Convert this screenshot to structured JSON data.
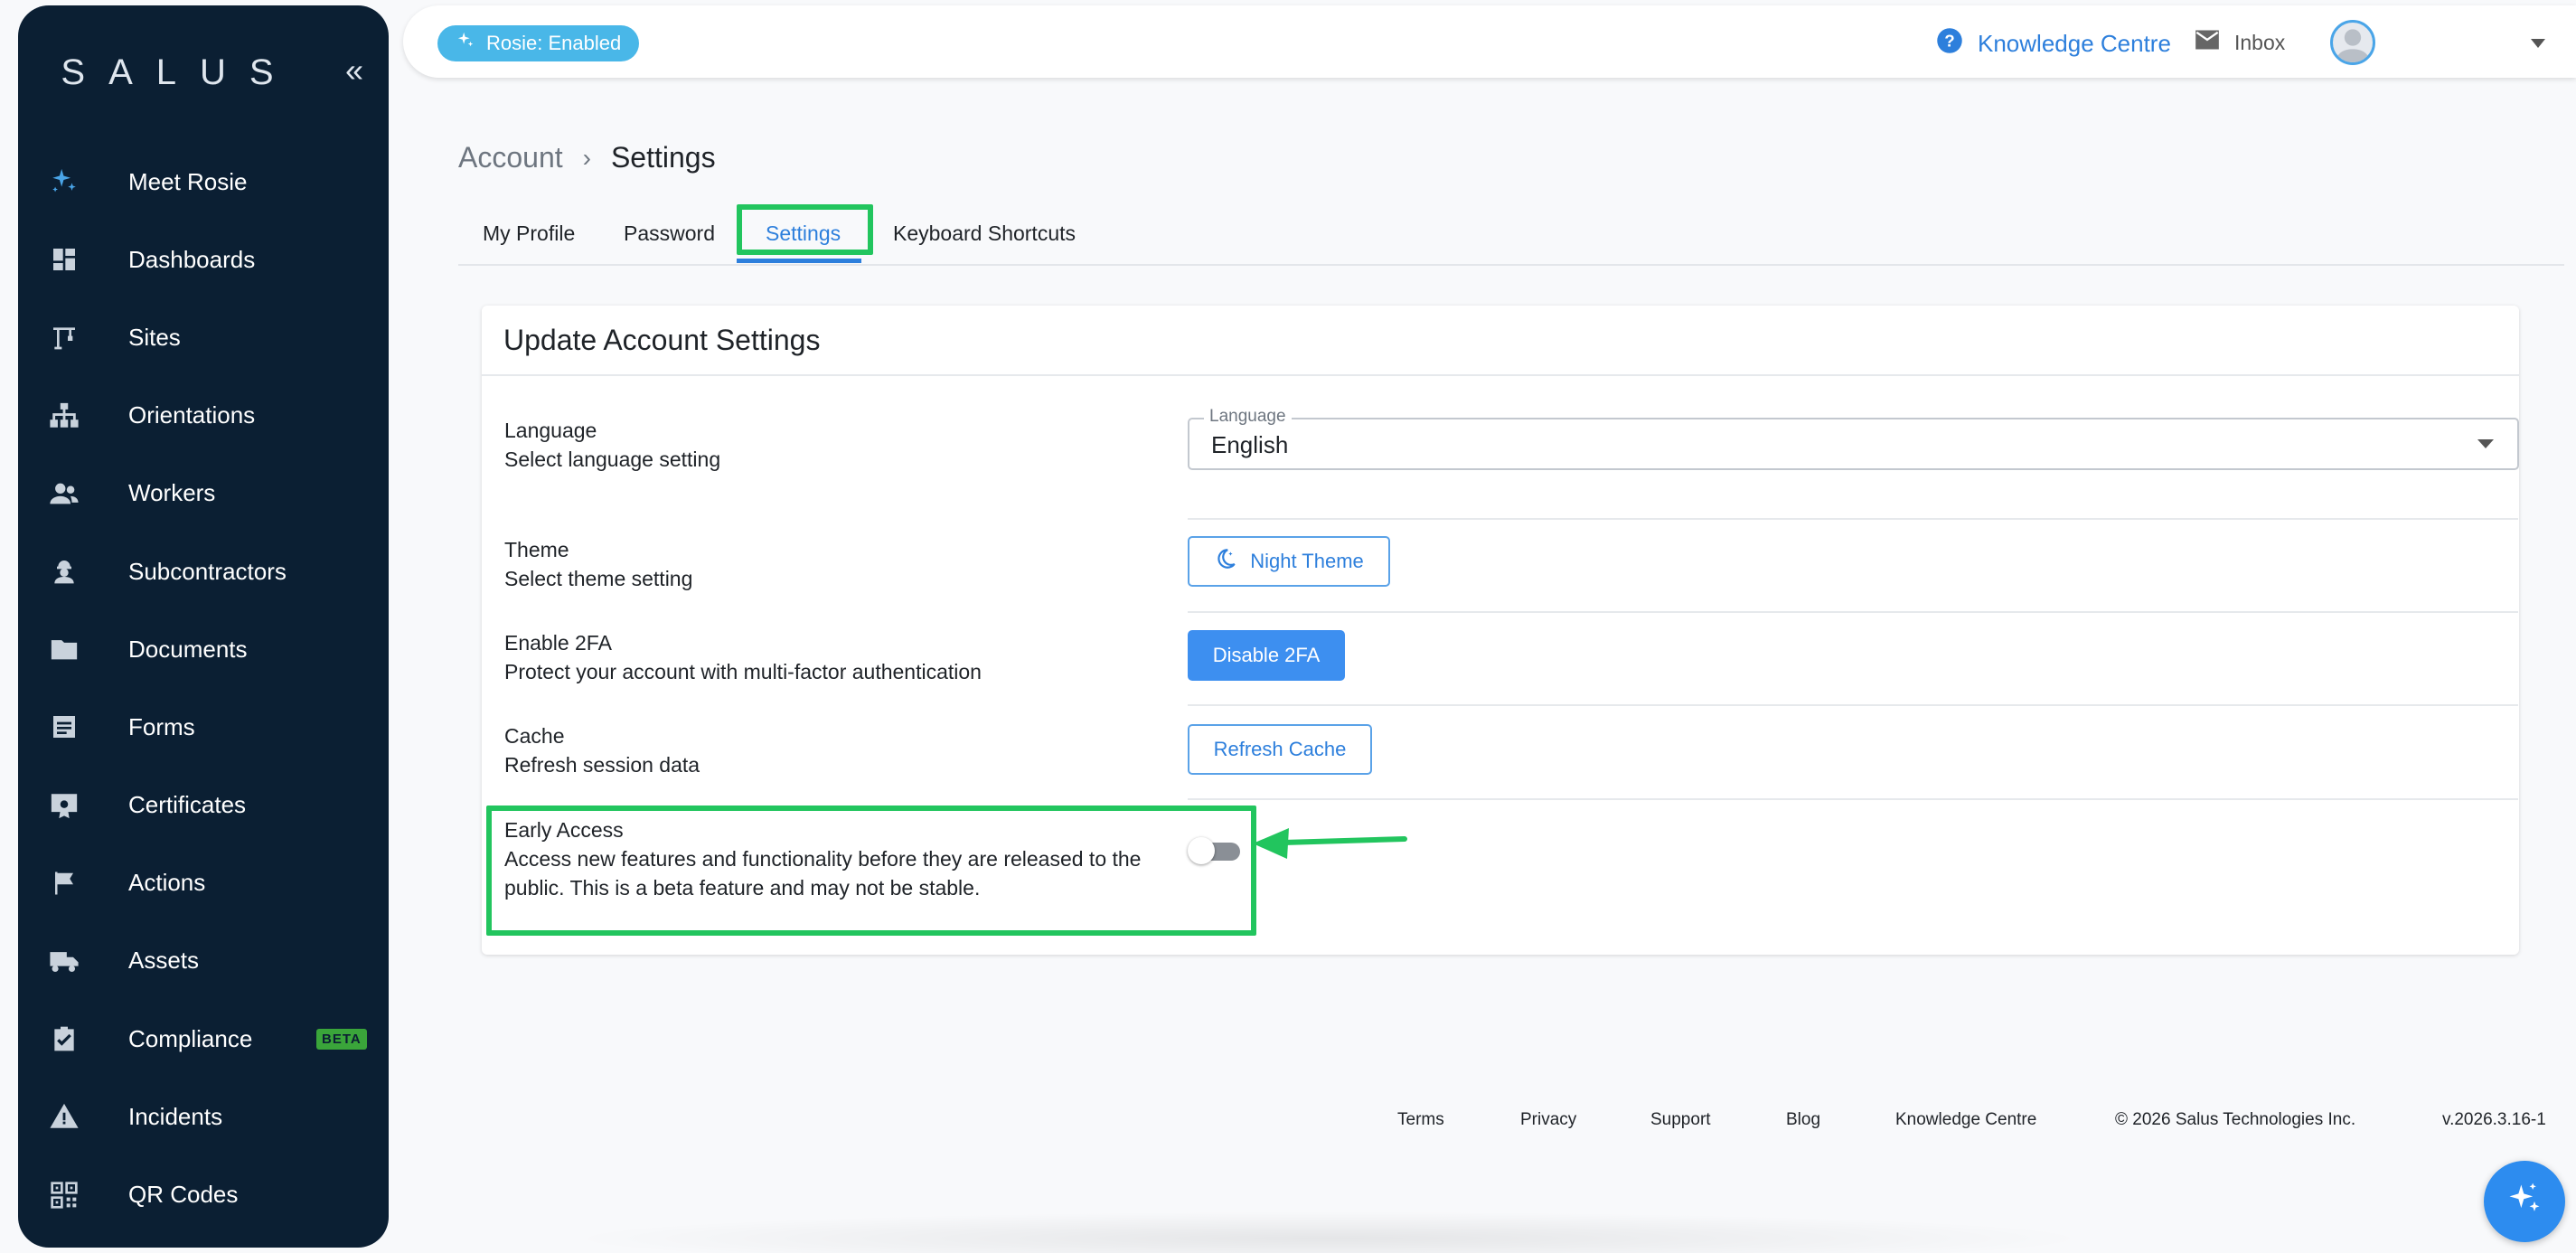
{
  "sidebar": {
    "logo": "SALUS",
    "collapse_glyph": "«",
    "items": [
      {
        "label": "Meet Rosie",
        "icon": "sparkle-icon"
      },
      {
        "label": "Dashboards",
        "icon": "dashboard-icon"
      },
      {
        "label": "Sites",
        "icon": "crane-icon"
      },
      {
        "label": "Orientations",
        "icon": "org-chart-icon"
      },
      {
        "label": "Workers",
        "icon": "people-icon"
      },
      {
        "label": "Subcontractors",
        "icon": "engineer-icon"
      },
      {
        "label": "Documents",
        "icon": "folder-icon"
      },
      {
        "label": "Forms",
        "icon": "form-icon"
      },
      {
        "label": "Certificates",
        "icon": "certificate-icon"
      },
      {
        "label": "Actions",
        "icon": "flag-icon"
      },
      {
        "label": "Assets",
        "icon": "truck-icon"
      },
      {
        "label": "Compliance",
        "icon": "clipboard-check-icon",
        "badge": "BETA"
      },
      {
        "label": "Incidents",
        "icon": "warning-icon"
      },
      {
        "label": "QR Codes",
        "icon": "qr-code-icon"
      }
    ]
  },
  "topbar": {
    "rosie_label": "Rosie: Enabled",
    "knowledge_centre": "Knowledge Centre",
    "inbox": "Inbox"
  },
  "breadcrumb": {
    "parent": "Account",
    "separator": "›",
    "current": "Settings"
  },
  "tabs": [
    {
      "label": "My Profile",
      "active": false
    },
    {
      "label": "Password",
      "active": false
    },
    {
      "label": "Settings",
      "active": true
    },
    {
      "label": "Keyboard Shortcuts",
      "active": false
    }
  ],
  "card": {
    "title": "Update Account Settings",
    "language": {
      "title": "Language",
      "desc": "Select language setting",
      "field_label": "Language",
      "value": "English"
    },
    "theme": {
      "title": "Theme",
      "desc": "Select theme setting",
      "button": "Night Theme"
    },
    "twofa": {
      "title": "Enable 2FA",
      "desc": "Protect your account with multi-factor authentication",
      "button": "Disable 2FA"
    },
    "cache": {
      "title": "Cache",
      "desc": "Refresh session data",
      "button": "Refresh Cache"
    },
    "early_access": {
      "title": "Early Access",
      "desc": "Access new features and functionality before they are released to the public. This is a beta feature and may not be stable.",
      "enabled": false
    }
  },
  "footer": {
    "terms": "Terms",
    "privacy": "Privacy",
    "support": "Support",
    "blog": "Blog",
    "knowledge_centre": "Knowledge Centre",
    "copyright": "© 2026 Salus Technologies Inc.",
    "version": "v.2026.3.16-1"
  },
  "colors": {
    "sidebar_bg": "#0b1f33",
    "accent": "#2d7fdc",
    "highlight": "#22c55e",
    "beta_badge": "#3aa53a"
  }
}
